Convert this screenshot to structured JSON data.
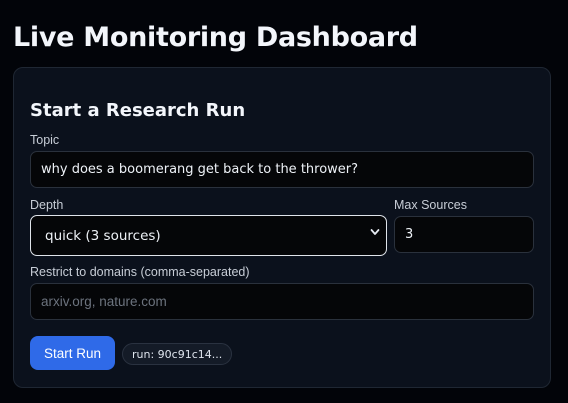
{
  "header": {
    "title": "Live Monitoring Dashboard"
  },
  "form": {
    "title": "Start a Research Run",
    "topic": {
      "label": "Topic",
      "value": "why does a boomerang get back to the thrower?"
    },
    "depth": {
      "label": "Depth",
      "selected": "quick (3 sources)"
    },
    "max_sources": {
      "label": "Max Sources",
      "value": "3"
    },
    "domains": {
      "label": "Restrict to domains (comma-separated)",
      "placeholder": "arxiv.org, nature.com",
      "value": ""
    },
    "submit_label": "Start Run",
    "run_badge": "run: 90c91c14..."
  },
  "icons": {
    "select_arrow": "chevron-down-icon"
  },
  "colors": {
    "accent": "#2f6ae8",
    "background": "#020409",
    "card": "#0b111c"
  }
}
